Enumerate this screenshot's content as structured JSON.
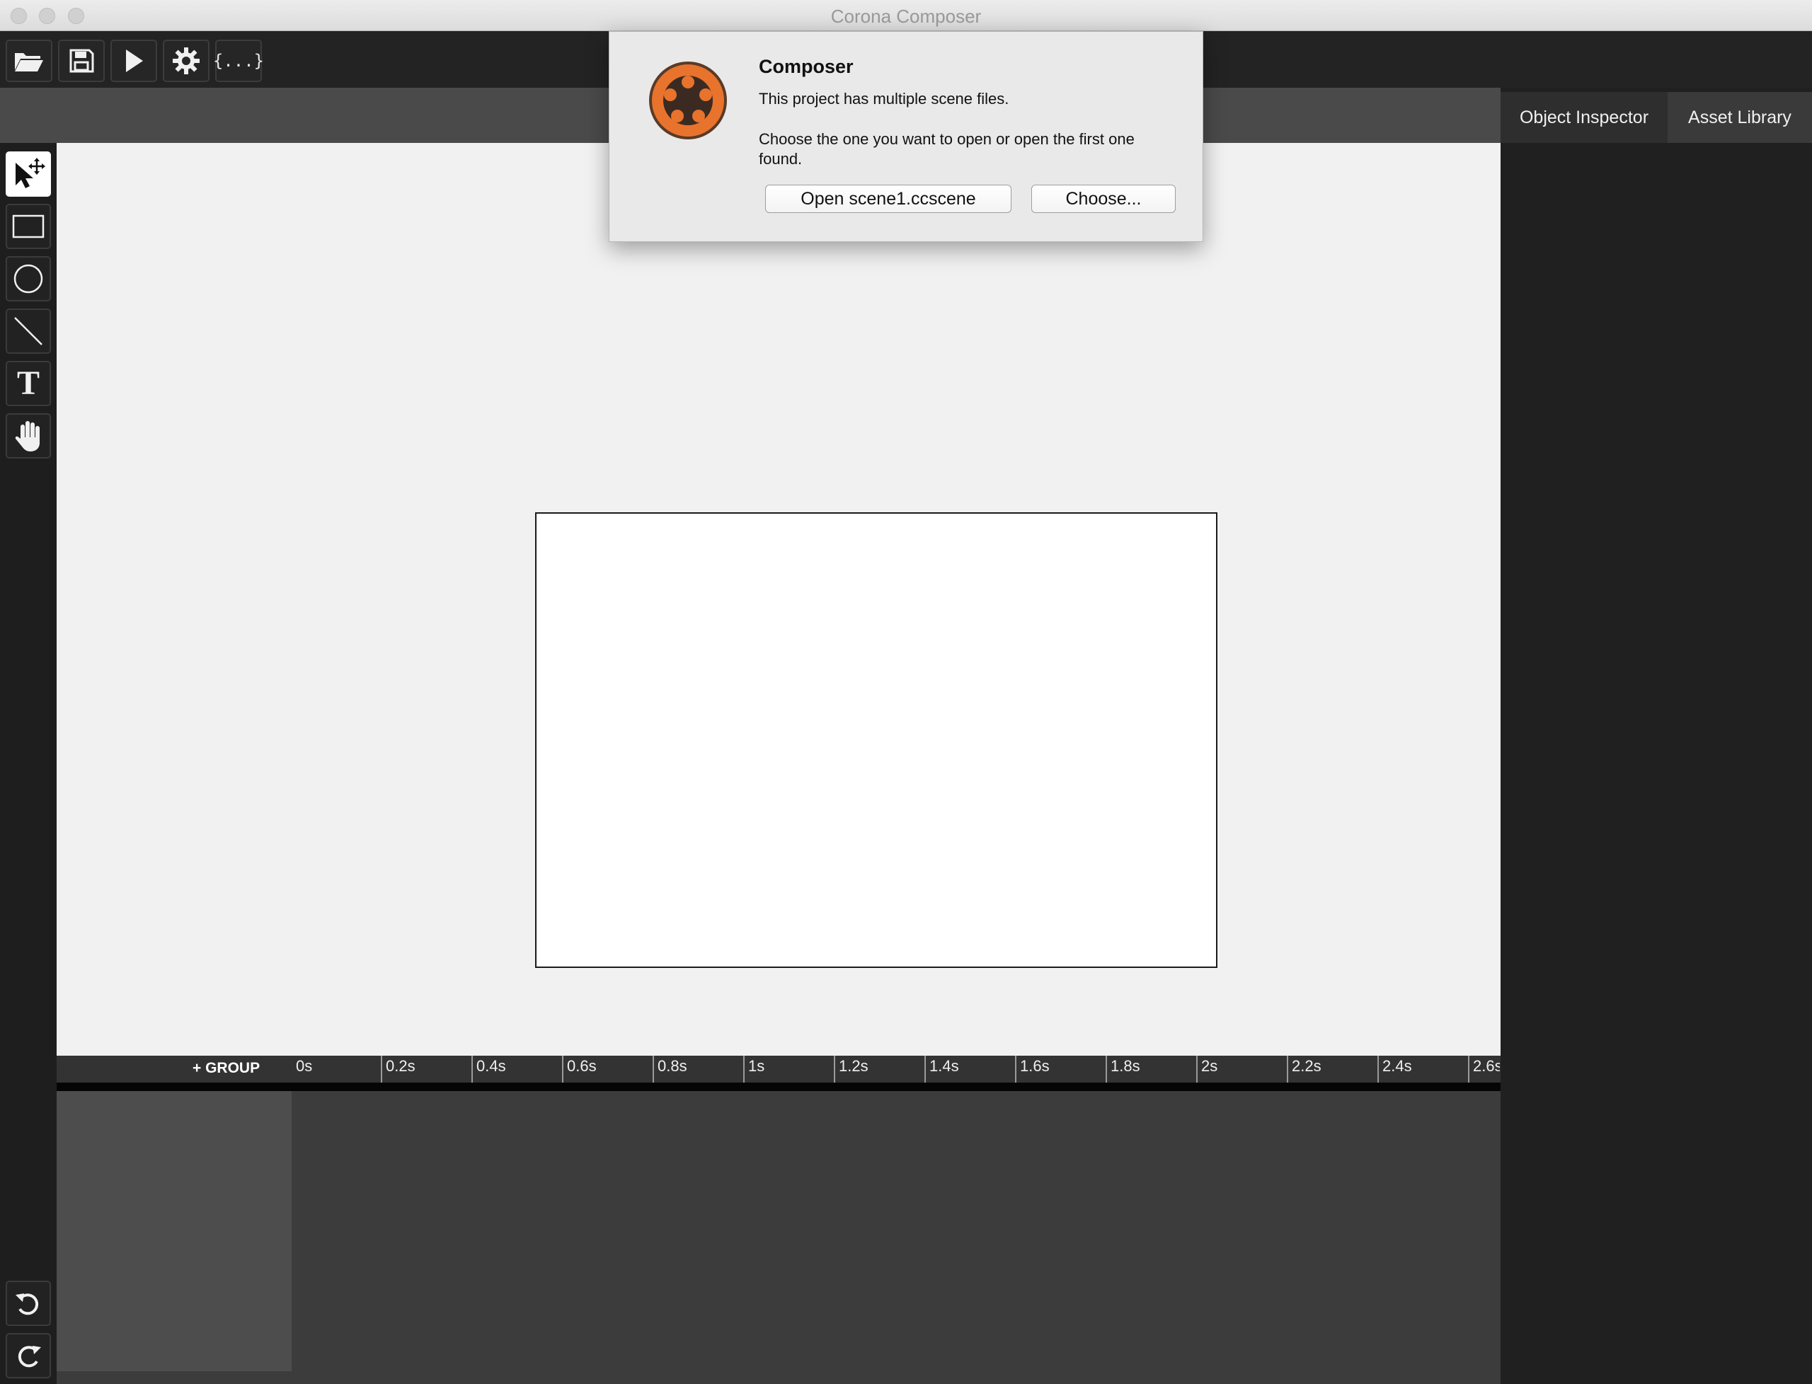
{
  "window": {
    "title": "Corona Composer"
  },
  "toolbar": {
    "buttons": [
      {
        "name": "open-folder",
        "icon": "folder-open-icon"
      },
      {
        "name": "save",
        "icon": "save-icon"
      },
      {
        "name": "play",
        "icon": "play-icon"
      },
      {
        "name": "settings",
        "icon": "gear-icon"
      },
      {
        "name": "code",
        "icon": "code-braces-icon",
        "label": "{...}"
      }
    ]
  },
  "tabs": [
    {
      "label": "Object Inspector",
      "active": true
    },
    {
      "label": "Asset Library",
      "active": false
    }
  ],
  "tools": [
    {
      "name": "select-move",
      "icon": "pointer-move-icon",
      "active": true
    },
    {
      "name": "rectangle",
      "icon": "rectangle-icon"
    },
    {
      "name": "circle",
      "icon": "circle-icon"
    },
    {
      "name": "line",
      "icon": "line-icon"
    },
    {
      "name": "text",
      "icon": "text-icon",
      "label": "T"
    },
    {
      "name": "hand",
      "icon": "hand-icon"
    }
  ],
  "history": [
    {
      "name": "undo",
      "icon": "undo-icon"
    },
    {
      "name": "redo",
      "icon": "redo-icon"
    }
  ],
  "timeline": {
    "group_label": "+ GROUP",
    "ticks": [
      "0s",
      "0.2s",
      "0.4s",
      "0.6s",
      "0.8s",
      "1s",
      "1.2s",
      "1.4s",
      "1.6s",
      "1.8s",
      "2s",
      "2.2s",
      "2.4s",
      "2.6s"
    ]
  },
  "dialog": {
    "title": "Composer",
    "message1": "This project has multiple scene files.",
    "message2": "Choose the one you want to open or open the first one found.",
    "open_button": "Open scene1.ccscene",
    "choose_button": "Choose..."
  },
  "colors": {
    "logo_orange": "#e8732c",
    "canvas_bg": "#f1f1f1",
    "toolbar_bg": "#232323"
  }
}
